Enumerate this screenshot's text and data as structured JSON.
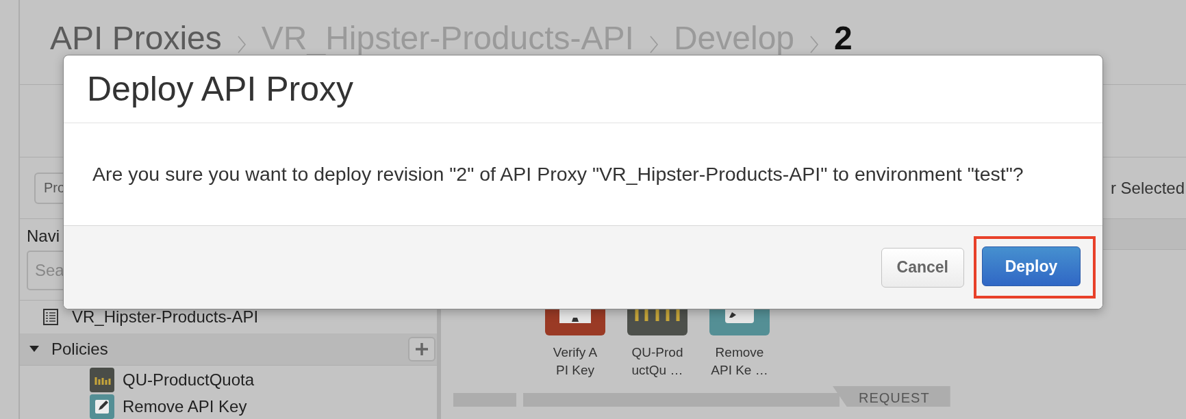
{
  "breadcrumb": [
    {
      "label": "API Proxies",
      "kind": "root"
    },
    {
      "label": "VR_Hipster-Products-API",
      "kind": "trail"
    },
    {
      "label": "Develop",
      "kind": "trail"
    },
    {
      "label": "2",
      "kind": "current"
    }
  ],
  "toolbar": {
    "button_label": "Pro",
    "status": "r Selected"
  },
  "navigator": {
    "label": "Navi",
    "search": {
      "placeholder": "Sea"
    },
    "tree": [
      {
        "kind": "proxy",
        "label": "VR_Hipster-Products-API"
      },
      {
        "kind": "folder",
        "label": "Policies",
        "expanded": true,
        "children": [
          {
            "kind": "quota",
            "label": "QU-ProductQuota"
          },
          {
            "kind": "remove-key",
            "label": "Remove API Key"
          }
        ]
      }
    ]
  },
  "flow": {
    "steps": [
      {
        "kind": "verify-key",
        "lines": [
          "Verify A",
          "PI Key"
        ]
      },
      {
        "kind": "quota",
        "lines": [
          "QU-Prod",
          "uctQu …"
        ]
      },
      {
        "kind": "remove-key",
        "lines": [
          "Remove",
          "API Ke …"
        ]
      }
    ],
    "direction": "REQUEST"
  },
  "dialog": {
    "title": "Deploy API Proxy",
    "message": "Are you sure you want to deploy revision \"2\" of API Proxy \"VR_Hipster-Products-API\" to environment \"test\"?",
    "buttons": [
      {
        "label": "Cancel",
        "kind": "secondary",
        "highlighted": false
      },
      {
        "label": "Deploy",
        "kind": "primary",
        "highlighted": true
      }
    ]
  }
}
